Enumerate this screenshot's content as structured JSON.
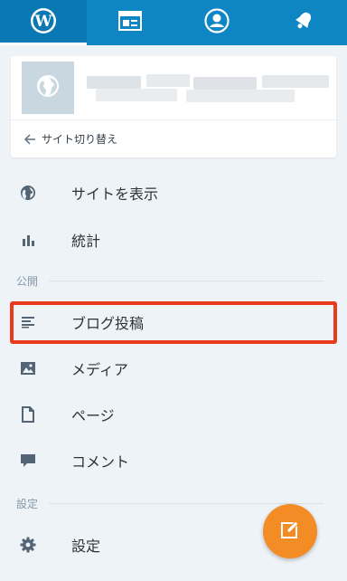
{
  "topbar": {
    "tabs": [
      {
        "name": "wordpress-logo-icon",
        "active": true
      },
      {
        "name": "reader-icon",
        "active": false
      },
      {
        "name": "profile-icon",
        "active": false
      },
      {
        "name": "notifications-bell-icon",
        "active": false
      }
    ],
    "color": "#0f86c4"
  },
  "site_card": {
    "switch_label": "サイト切り替え"
  },
  "menu": {
    "view_site": "サイトを表示",
    "stats": "統計",
    "section_publish": "公開",
    "blog_posts": "ブログ投稿",
    "media": "メディア",
    "pages": "ページ",
    "comments": "コメント",
    "section_settings": "設定",
    "settings": "設定"
  },
  "highlight_color": "#ea3a1e",
  "fab": {
    "icon": "compose-icon",
    "color": "#f48c25"
  }
}
